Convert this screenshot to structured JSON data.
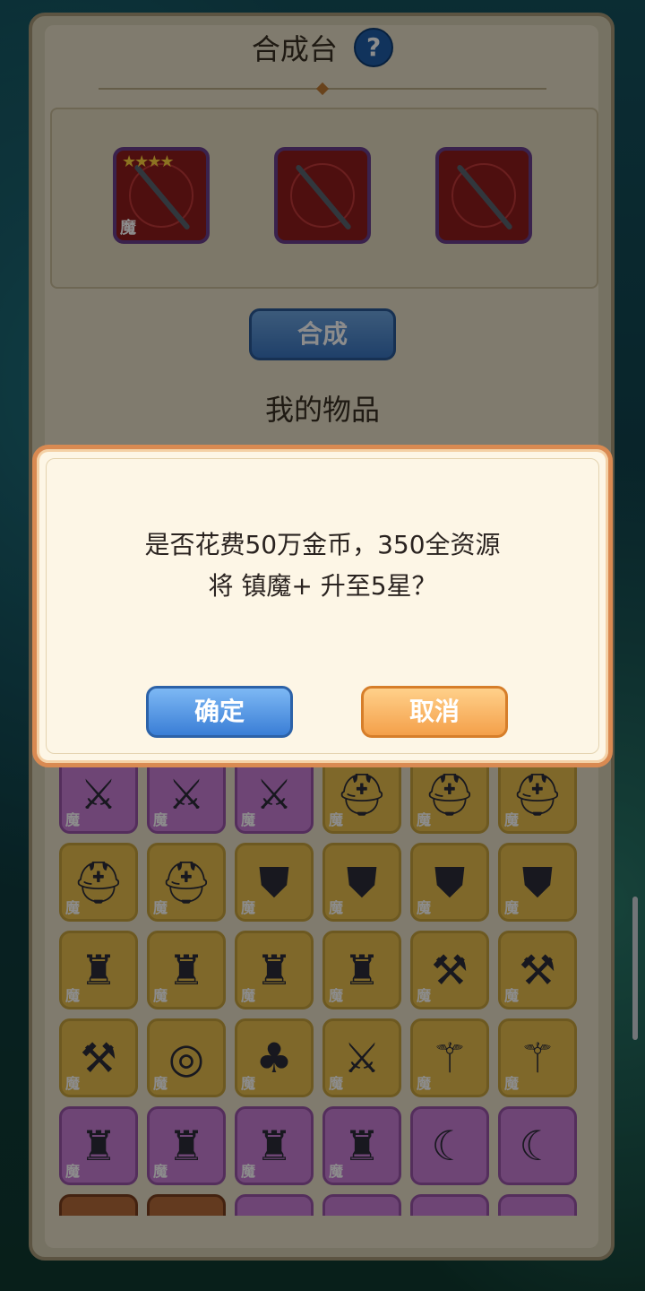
{
  "craft_panel": {
    "title": "合成台",
    "help_icon": "?",
    "slots": [
      {
        "icon": "sword-icon",
        "stars": "★★★★",
        "tag": "魔"
      },
      {
        "icon": "sword-icon",
        "stars": "",
        "tag": ""
      },
      {
        "icon": "sword-icon",
        "stars": "",
        "tag": ""
      }
    ],
    "craft_button": "合成",
    "items_title": "我的物品"
  },
  "inventory": {
    "tag": "魔",
    "rows": [
      [
        "sword-icon",
        "sword-icon",
        "sword-icon",
        "helmet-icon",
        "helmet-icon",
        "helmet-icon"
      ],
      [
        "helmet-icon",
        "helmet-icon",
        "shield-icon",
        "shield-icon",
        "shield-icon",
        "shield-icon"
      ],
      [
        "armor-icon",
        "armor-icon",
        "armor-icon",
        "armor-icon",
        "axe-icon",
        "axe-icon"
      ],
      [
        "axe-icon",
        "ring-icon",
        "bag-icon",
        "sword-icon",
        "staff-icon",
        "staff-icon"
      ],
      [
        "armor-icon",
        "armor-icon",
        "armor-icon",
        "armor-icon",
        "necklace-icon",
        "necklace-icon"
      ],
      [
        "cloak-icon",
        "cloak-icon",
        "blade-icon",
        "sword-icon",
        "sword-icon",
        "gem-icon"
      ]
    ]
  },
  "dialog": {
    "line1": "是否花费50万金币，350全资源",
    "line2": "将 镇魔+ 升至5星？",
    "confirm": "确定",
    "cancel": "取消"
  }
}
